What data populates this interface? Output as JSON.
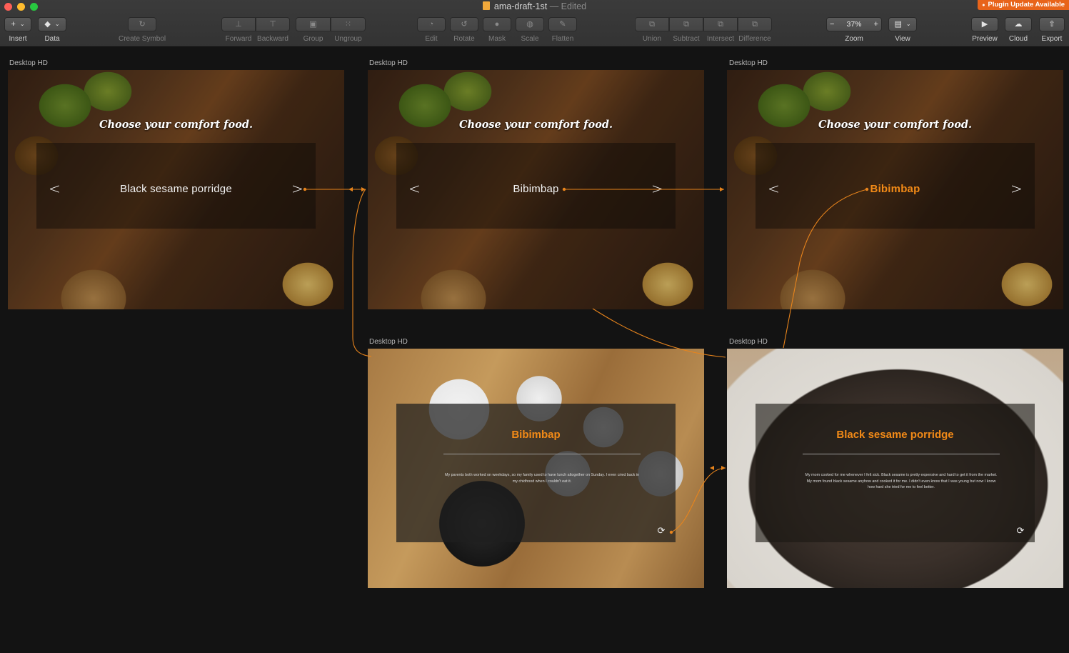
{
  "window": {
    "doc_name": "ama-draft-1st",
    "doc_status": "— Edited",
    "plugin_badge": "Plugin Update Available"
  },
  "toolbar": {
    "insert": {
      "glyph": "+",
      "label": "Insert"
    },
    "data": {
      "label": "Data"
    },
    "create_symbol": {
      "label": "Create Symbol"
    },
    "arrange": [
      {
        "label": "Forward"
      },
      {
        "label": "Backward"
      }
    ],
    "group": [
      {
        "label": "Group"
      },
      {
        "label": "Ungroup"
      }
    ],
    "edit_tools": [
      {
        "label": "Edit"
      },
      {
        "label": "Rotate"
      },
      {
        "label": "Mask"
      },
      {
        "label": "Scale"
      },
      {
        "label": "Flatten"
      }
    ],
    "boolean_ops": [
      {
        "label": "Union"
      },
      {
        "label": "Subtract"
      },
      {
        "label": "Intersect"
      },
      {
        "label": "Difference"
      }
    ],
    "zoom": {
      "minus": "−",
      "value": "37%",
      "plus": "+",
      "label": "Zoom"
    },
    "view": {
      "label": "View"
    },
    "preview": {
      "label": "Preview"
    },
    "cloud": {
      "label": "Cloud"
    },
    "export": {
      "label": "Export"
    }
  },
  "artboards": [
    {
      "label": "Desktop HD",
      "headline": "Choose your comfort food.",
      "dish": "Black sesame porridge",
      "prev": "<",
      "next": ">"
    },
    {
      "label": "Desktop HD",
      "headline": "Choose your comfort food.",
      "dish": "Bibimbap",
      "prev": "<",
      "next": ">"
    },
    {
      "label": "Desktop HD",
      "headline": "Choose your comfort food.",
      "dish": "Bibimbap",
      "prev": "<",
      "next": ">"
    },
    {
      "label": "Desktop HD",
      "title": "Bibimbap",
      "body": "My parents both worked on weekdays, so my family used to have lunch altogether on Sunday. I even cried back in my chidhood when I couldn't eat it."
    },
    {
      "label": "Desktop HD",
      "title": "Black sesame porridge",
      "body": "My mom cooked for me whenever I felt sick. Black sesame is pretty expensive and hard to get it from the market. My mom found black sesame anyhow and cooked it for me. I didn't even know that I was young but now I know how hard she tried for me to feel better."
    }
  ],
  "colors": {
    "accent": "#f28a17",
    "canvas": "#131313",
    "toolbar": "#383838",
    "link_line": "#e8841c"
  }
}
